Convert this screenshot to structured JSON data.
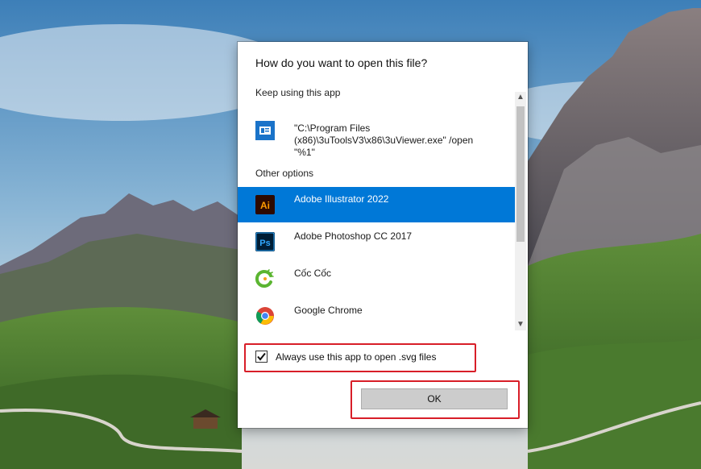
{
  "dialog": {
    "title": "How do you want to open this file?",
    "keep_using_label": "Keep using this app",
    "current_app": {
      "icon": "generic-app-window-icon",
      "line1": "\"C:\\Program Files",
      "line2": "(x86)\\3uToolsV3\\x86\\3uViewer.exe\" /open",
      "line3": "\"%1\""
    },
    "other_options_label": "Other options",
    "apps": [
      {
        "name": "Adobe Illustrator 2022",
        "icon": "adobe-illustrator-icon",
        "selected": true
      },
      {
        "name": "Adobe Photoshop CC 2017",
        "icon": "adobe-photoshop-icon",
        "selected": false
      },
      {
        "name": "Cốc Cốc",
        "icon": "coc-coc-browser-icon",
        "selected": false
      },
      {
        "name": "Google Chrome",
        "icon": "google-chrome-icon",
        "selected": false
      }
    ],
    "always_use_checkbox": {
      "label": "Always use this app to open .svg files",
      "checked": true
    },
    "ok_button": "OK"
  },
  "colors": {
    "selection_blue": "#0078d7",
    "highlight_red": "#d81e28",
    "illustrator_bg": "#2d0a00",
    "illustrator_fg": "#ff9a00",
    "photoshop_bg": "#001e36",
    "photoshop_fg": "#31a8ff"
  }
}
